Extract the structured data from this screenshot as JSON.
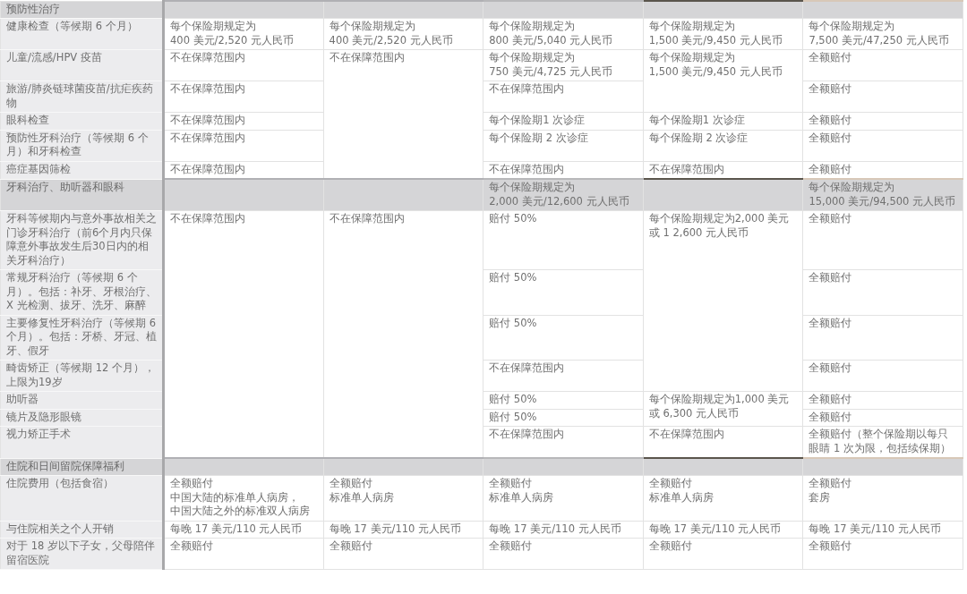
{
  "sections": [
    {
      "title": "预防性治疗",
      "cells": [
        {
          "kind": "empty"
        },
        {
          "kind": "empty"
        },
        {
          "kind": "empty"
        },
        {
          "kind": "empty"
        },
        {
          "kind": "empty"
        }
      ],
      "rows": [
        {
          "label": "健康检查（等候期 6 个月）",
          "cells": [
            {
              "kind": "text",
              "lines": [
                "每个保险期规定为",
                "400 美元/2,520 元人民币"
              ]
            },
            {
              "kind": "text",
              "lines": [
                "每个保险期规定为",
                "400 美元/2,520 元人民币"
              ]
            },
            {
              "kind": "text",
              "lines": [
                "每个保险期规定为",
                "800 美元/5,040 元人民币"
              ]
            },
            {
              "kind": "text",
              "lines": [
                "每个保险期规定为",
                "1,500 美元/9,450 元人民币"
              ]
            },
            {
              "kind": "text",
              "lines": [
                "每个保险期规定为",
                "7,500 美元/47,250 元人民币"
              ]
            }
          ]
        },
        {
          "label": "儿童/流感/HPV 疫苗",
          "cells": [
            {
              "kind": "text",
              "lines": [
                "不在保障范围内"
              ]
            },
            {
              "kind": "text",
              "lines": [
                "不在保障范围内"
              ],
              "rowspan": 5
            },
            {
              "kind": "text",
              "lines": [
                "每个保险期规定为",
                "750 美元/4,725 元人民币"
              ]
            },
            {
              "kind": "text",
              "lines": [
                "每个保险期规定为",
                "1,500 美元/9,450 元人民币"
              ],
              "rowspan": 2
            },
            {
              "kind": "text",
              "lines": [
                "全额赔付"
              ]
            }
          ]
        },
        {
          "label": "旅游/肺炎链球菌疫苗/抗疟疾药物",
          "cells": [
            {
              "kind": "text",
              "lines": [
                "不在保障范围内"
              ]
            },
            {
              "kind": "text",
              "lines": [
                "不在保障范围内"
              ]
            },
            {
              "kind": "text",
              "lines": [
                "全额赔付"
              ]
            }
          ]
        },
        {
          "label": "眼科检查",
          "cells": [
            {
              "kind": "text",
              "lines": [
                "不在保障范围内"
              ]
            },
            {
              "kind": "text",
              "lines": [
                "每个保险期1 次诊症"
              ]
            },
            {
              "kind": "text",
              "lines": [
                "每个保险期1 次诊症"
              ]
            },
            {
              "kind": "text",
              "lines": [
                "全额赔付"
              ]
            }
          ]
        },
        {
          "label": "预防性牙科治疗（等候期 6 个月）和牙科检查",
          "cells": [
            {
              "kind": "text",
              "lines": [
                "不在保障范围内"
              ]
            },
            {
              "kind": "text",
              "lines": [
                "每个保险期 2 次诊症"
              ]
            },
            {
              "kind": "text",
              "lines": [
                "每个保险期 2 次诊症"
              ]
            },
            {
              "kind": "text",
              "lines": [
                "全额赔付"
              ]
            }
          ]
        },
        {
          "label": "癌症基因筛检",
          "cells": [
            {
              "kind": "text",
              "lines": [
                "不在保障范围内"
              ]
            },
            {
              "kind": "text",
              "lines": [
                "不在保障范围内"
              ]
            },
            {
              "kind": "text",
              "lines": [
                "不在保障范围内"
              ]
            },
            {
              "kind": "text",
              "lines": [
                "全额赔付"
              ]
            }
          ]
        }
      ]
    },
    {
      "title": "牙科治疗、助听器和眼科",
      "cells": [
        {
          "kind": "empty"
        },
        {
          "kind": "empty"
        },
        {
          "kind": "text",
          "lines": [
            "每个保险期规定为",
            "2,000 美元/12,600 元人民币"
          ]
        },
        {
          "kind": "empty"
        },
        {
          "kind": "text",
          "lines": [
            "每个保险期规定为",
            "15,000 美元/94,500 元人民币"
          ]
        }
      ],
      "rows": [
        {
          "label": "牙科等候期内与意外事故相关之门诊牙科治疗（前6个月内只保障意外事故发生后30日内的相关牙科治疗）",
          "cells": [
            {
              "kind": "text",
              "lines": [
                "不在保障范围内"
              ],
              "rowspan": 7
            },
            {
              "kind": "text",
              "lines": [
                "不在保障范围内"
              ],
              "rowspan": 7
            },
            {
              "kind": "text",
              "lines": [
                "赔付 50%"
              ]
            },
            {
              "kind": "text",
              "lines": [
                "每个保险期规定为2,000 美元或 1 2,600 元人民币"
              ],
              "rowspan": 4
            },
            {
              "kind": "text",
              "lines": [
                "全额赔付"
              ]
            }
          ]
        },
        {
          "label": "常规牙科治疗（等候期 6 个月）。包括：补牙、牙根治疗、X 光检测、拔牙、洗牙、麻醉",
          "cells": [
            {
              "kind": "text",
              "lines": [
                "赔付 50%"
              ]
            },
            {
              "kind": "text",
              "lines": [
                "全额赔付"
              ]
            }
          ]
        },
        {
          "label": "主要修复性牙科治疗（等候期 6 个月）。包括：牙桥、牙冠、植牙、假牙",
          "cells": [
            {
              "kind": "text",
              "lines": [
                "赔付 50%"
              ]
            },
            {
              "kind": "text",
              "lines": [
                "全额赔付"
              ]
            }
          ]
        },
        {
          "label": "畸齿矫正（等候期 12 个月），上限为19岁",
          "cells": [
            {
              "kind": "text",
              "lines": [
                "不在保障范围内"
              ]
            },
            {
              "kind": "text",
              "lines": [
                "全额赔付"
              ]
            }
          ]
        },
        {
          "label": "助听器",
          "cells": [
            {
              "kind": "text",
              "lines": [
                "赔付 50%"
              ]
            },
            {
              "kind": "text",
              "lines": [
                "每个保险期规定为1,000 美元或 6,300 元人民币"
              ],
              "rowspan": 2
            },
            {
              "kind": "text",
              "lines": [
                "全额赔付"
              ]
            }
          ]
        },
        {
          "label": "镜片及隐形眼镜",
          "cells": [
            {
              "kind": "text",
              "lines": [
                "赔付 50%"
              ]
            },
            {
              "kind": "text",
              "lines": [
                "全额赔付"
              ]
            }
          ]
        },
        {
          "label": "视力矫正手术",
          "cells": [
            {
              "kind": "text",
              "lines": [
                "不在保障范围内"
              ]
            },
            {
              "kind": "text",
              "lines": [
                "不在保障范围内"
              ]
            },
            {
              "kind": "text",
              "lines": [
                "全额赔付（整个保险期以每只眼睛 1 次为限，包括续保期）"
              ]
            }
          ]
        }
      ]
    },
    {
      "title": "住院和日间留院保障福利",
      "cells": [
        {
          "kind": "empty"
        },
        {
          "kind": "empty"
        },
        {
          "kind": "empty"
        },
        {
          "kind": "empty"
        },
        {
          "kind": "empty"
        }
      ],
      "rows": [
        {
          "label": "住院费用（包括食宿）",
          "cells": [
            {
              "kind": "text",
              "lines": [
                "全额赔付",
                "中国大陆的标准单人病房，",
                "中国大陆之外的标准双人病房"
              ]
            },
            {
              "kind": "text",
              "lines": [
                "全额赔付",
                "标准单人病房"
              ]
            },
            {
              "kind": "text",
              "lines": [
                "全额赔付",
                "标准单人病房"
              ]
            },
            {
              "kind": "text",
              "lines": [
                "全额赔付",
                "标准单人病房"
              ]
            },
            {
              "kind": "text",
              "lines": [
                "全额赔付",
                "套房"
              ]
            }
          ]
        },
        {
          "label": "与住院相关之个人开销",
          "cells": [
            {
              "kind": "text",
              "lines": [
                "每晚 17 美元/110 元人民币"
              ]
            },
            {
              "kind": "text",
              "lines": [
                "每晚 17 美元/110 元人民币"
              ]
            },
            {
              "kind": "text",
              "lines": [
                "每晚 17 美元/110 元人民币"
              ]
            },
            {
              "kind": "text",
              "lines": [
                "每晚 17 美元/110 元人民币"
              ]
            },
            {
              "kind": "text",
              "lines": [
                "每晚 17 美元/110 元人民币"
              ]
            }
          ]
        },
        {
          "label": "对于 18 岁以下子女，父母陪伴留宿医院",
          "cells": [
            {
              "kind": "text",
              "lines": [
                "全额赔付"
              ]
            },
            {
              "kind": "text",
              "lines": [
                "全额赔付"
              ]
            },
            {
              "kind": "text",
              "lines": [
                "全额赔付"
              ]
            },
            {
              "kind": "text",
              "lines": [
                "全额赔付"
              ]
            },
            {
              "kind": "text",
              "lines": [
                "全额赔付"
              ]
            }
          ]
        }
      ]
    }
  ]
}
